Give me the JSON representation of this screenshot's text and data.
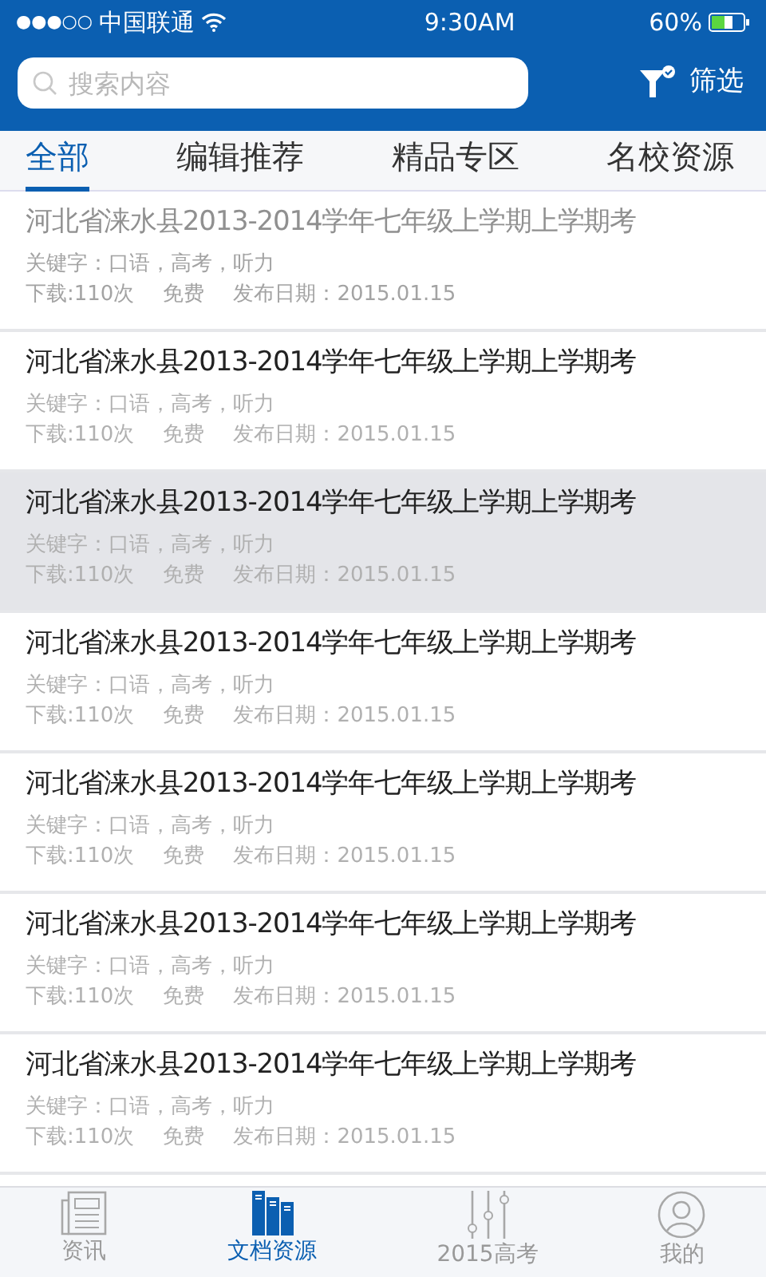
{
  "status_bar": {
    "signal": "●●●○○",
    "carrier": "中国联通",
    "time": "9:30AM",
    "battery": "60%"
  },
  "search": {
    "placeholder": "搜索内容"
  },
  "filter": {
    "label": "筛选"
  },
  "tabs": [
    {
      "label": "全部",
      "selected": true
    },
    {
      "label": "编辑推荐",
      "selected": false
    },
    {
      "label": "精品专区",
      "selected": false
    },
    {
      "label": "名校资源",
      "selected": false
    }
  ],
  "documents": [
    {
      "title": "河北省涞水县2013-2014学年七年级上学期上学期考",
      "keywords": "关键字：口语，高考，听力",
      "downloads": "下载:110次",
      "price": "免费",
      "date": "发布日期：2015.01.15",
      "dimmed": true,
      "selected": false
    },
    {
      "title": "河北省涞水县2013-2014学年七年级上学期上学期考",
      "keywords": "关键字：口语，高考，听力",
      "downloads": "下载:110次",
      "price": "免费",
      "date": "发布日期：2015.01.15",
      "dimmed": false,
      "selected": false
    },
    {
      "title": "河北省涞水县2013-2014学年七年级上学期上学期考",
      "keywords": "关键字：口语，高考，听力",
      "downloads": "下载:110次",
      "price": "免费",
      "date": "发布日期：2015.01.15",
      "dimmed": false,
      "selected": true
    },
    {
      "title": "河北省涞水县2013-2014学年七年级上学期上学期考",
      "keywords": "关键字：口语，高考，听力",
      "downloads": "下载:110次",
      "price": "免费",
      "date": "发布日期：2015.01.15",
      "dimmed": false,
      "selected": false
    },
    {
      "title": "河北省涞水县2013-2014学年七年级上学期上学期考",
      "keywords": "关键字：口语，高考，听力",
      "downloads": "下载:110次",
      "price": "免费",
      "date": "发布日期：2015.01.15",
      "dimmed": false,
      "selected": false
    },
    {
      "title": "河北省涞水县2013-2014学年七年级上学期上学期考",
      "keywords": "关键字：口语，高考，听力",
      "downloads": "下载:110次",
      "price": "免费",
      "date": "发布日期：2015.01.15",
      "dimmed": false,
      "selected": false
    },
    {
      "title": "河北省涞水县2013-2014学年七年级上学期上学期考",
      "keywords": "关键字：口语，高考，听力",
      "downloads": "下载:110次",
      "price": "免费",
      "date": "发布日期：2015.01.15",
      "dimmed": false,
      "selected": false
    }
  ],
  "bottom_tabs": [
    {
      "label": "资讯",
      "kind": "news",
      "selected": false
    },
    {
      "label": "文档资源",
      "kind": "books",
      "selected": true
    },
    {
      "label": "2015高考",
      "kind": "sliders",
      "selected": false
    },
    {
      "label": "我的",
      "kind": "profile",
      "selected": false
    }
  ]
}
